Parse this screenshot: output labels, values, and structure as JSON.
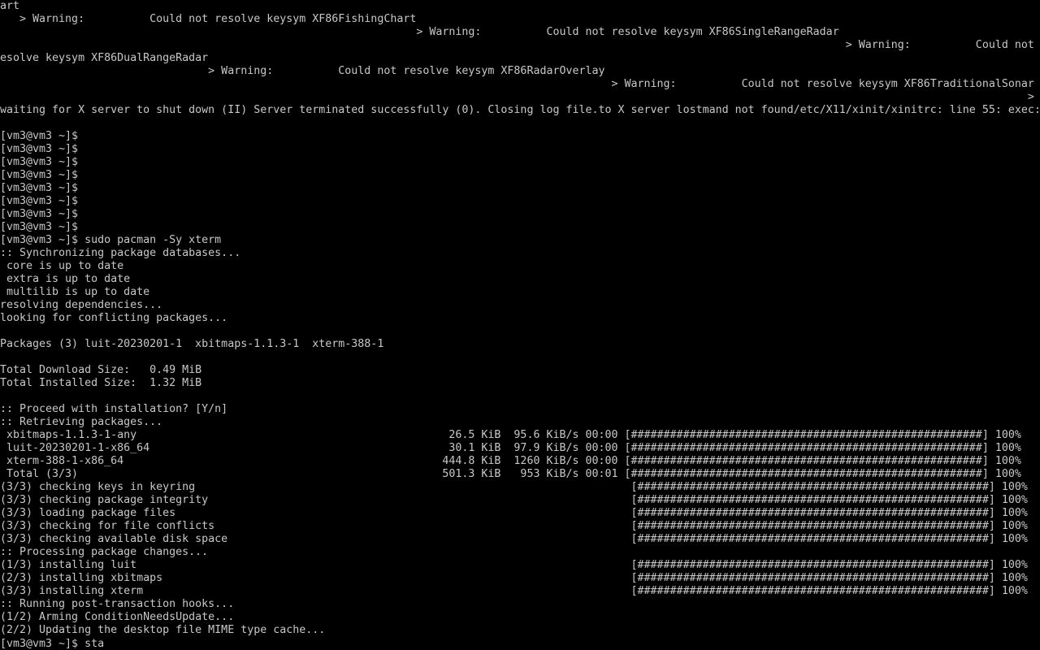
{
  "terminal": {
    "lines": [
      "art",
      "   > Warning:          Could not resolve keysym XF86FishingChart",
      "                                                                > Warning:          Could not resolve keysym XF86SingleRangeRadar",
      "                                                                                                                                  > Warning:          Could not r",
      "esolve keysym XF86DualRangeRadar",
      "                                > Warning:          Could not resolve keysym XF86RadarOverlay",
      "                                                                                              > Warning:          Could not resolve keysym XF86TraditionalSonar",
      "                                                                                                                                                              >",
      "waiting for X server to shut down (II) Server terminated successfully (0). Closing log file.to X server lostmand not found/etc/X11/xinit/xinitrc: line 55: exec:",
      "",
      "[vm3@vm3 ~]$",
      "[vm3@vm3 ~]$",
      "[vm3@vm3 ~]$",
      "[vm3@vm3 ~]$",
      "[vm3@vm3 ~]$",
      "[vm3@vm3 ~]$",
      "[vm3@vm3 ~]$",
      "[vm3@vm3 ~]$",
      "[vm3@vm3 ~]$ sudo pacman -Sy xterm",
      ":: Synchronizing package databases...",
      " core is up to date",
      " extra is up to date",
      " multilib is up to date",
      "resolving dependencies...",
      "looking for conflicting packages...",
      "",
      "Packages (3) luit-20230201-1  xbitmaps-1.1.3-1  xterm-388-1",
      "",
      "Total Download Size:   0.49 MiB",
      "Total Installed Size:  1.32 MiB",
      "",
      ":: Proceed with installation? [Y/n]",
      ":: Retrieving packages...",
      " xbitmaps-1.1.3-1-any                                                26.5 KiB  95.6 KiB/s 00:00 [######################################################] 100%",
      " luit-20230201-1-x86_64                                              30.1 KiB  97.9 KiB/s 00:00 [######################################################] 100%",
      " xterm-388-1-x86_64                                                 444.8 KiB  1260 KiB/s 00:00 [######################################################] 100%",
      " Total (3/3)                                                        501.3 KiB   953 KiB/s 00:01 [######################################################] 100%",
      "(3/3) checking keys in keyring                                                                   [######################################################] 100%",
      "(3/3) checking package integrity                                                                 [######################################################] 100%",
      "(3/3) loading package files                                                                      [######################################################] 100%",
      "(3/3) checking for file conflicts                                                                [######################################################] 100%",
      "(3/3) checking available disk space                                                              [######################################################] 100%",
      ":: Processing package changes...",
      "(1/3) installing luit                                                                            [######################################################] 100%",
      "(2/3) installing xbitmaps                                                                        [######################################################] 100%",
      "(3/3) installing xterm                                                                           [######################################################] 100%",
      ":: Running post-transaction hooks...",
      "(1/2) Arming ConditionNeedsUpdate...",
      "(2/2) Updating the desktop file MIME type cache..."
    ],
    "prompt": "[vm3@vm3 ~]$ ",
    "current_input": "sta"
  },
  "colors": {
    "background": "#000000",
    "foreground": "#c8c8c8"
  }
}
